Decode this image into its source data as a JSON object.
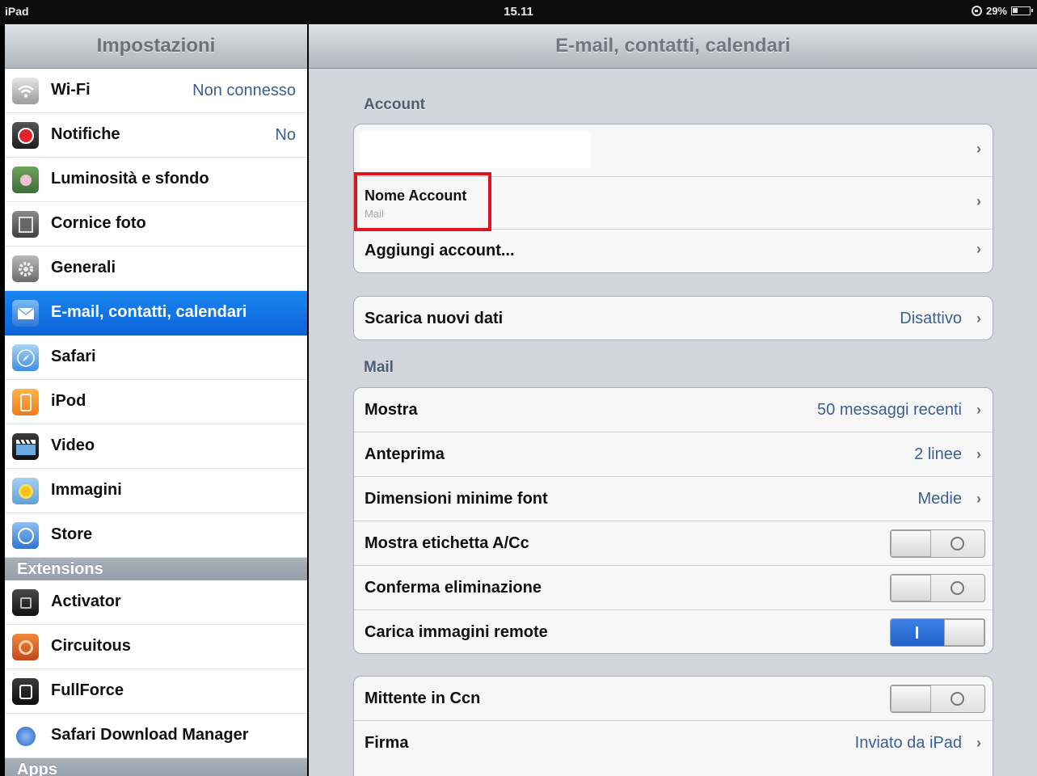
{
  "status_bar": {
    "device": "iPad",
    "time": "15.11",
    "battery": "29%"
  },
  "left_pane": {
    "title": "Impostazioni",
    "items": [
      {
        "label": "Wi-Fi",
        "value": "Non connesso",
        "icon": "wifi-icon"
      },
      {
        "label": "Notifiche",
        "value": "No",
        "icon": "notifications-icon"
      },
      {
        "label": "Luminosità e sfondo",
        "value": "",
        "icon": "brightness-wallpaper-icon"
      },
      {
        "label": "Cornice foto",
        "value": "",
        "icon": "picture-frame-icon"
      },
      {
        "label": "Generali",
        "value": "",
        "icon": "gear-icon"
      },
      {
        "label": "E-mail, contatti, calendari",
        "value": "",
        "icon": "mail-icon",
        "selected": true
      },
      {
        "label": "Safari",
        "value": "",
        "icon": "safari-compass-icon"
      },
      {
        "label": "iPod",
        "value": "",
        "icon": "ipod-icon"
      },
      {
        "label": "Video",
        "value": "",
        "icon": "video-clapper-icon"
      },
      {
        "label": "Immagini",
        "value": "",
        "icon": "sunflower-photos-icon"
      },
      {
        "label": "Store",
        "value": "",
        "icon": "store-icon"
      }
    ],
    "extensions_header": "Extensions",
    "extensions": [
      {
        "label": "Activator",
        "icon": "activator-icon"
      },
      {
        "label": "Circuitous",
        "icon": "circuitous-icon"
      },
      {
        "label": "FullForce",
        "icon": "fullforce-icon"
      },
      {
        "label": "Safari Download Manager",
        "icon": "download-manager-icon"
      }
    ],
    "apps_header": "Apps"
  },
  "right_pane": {
    "title": "E-mail, contatti, calendari",
    "account_header": "Account",
    "account_name": "Nome Account",
    "account_sub": "Mail",
    "add_account": "Aggiungi account...",
    "fetch_label": "Scarica nuovi dati",
    "fetch_value": "Disattivo",
    "mail_header": "Mail",
    "mail_rows": [
      {
        "label": "Mostra",
        "value": "50 messaggi recenti",
        "type": "disclosure"
      },
      {
        "label": "Anteprima",
        "value": "2 linee",
        "type": "disclosure"
      },
      {
        "label": "Dimensioni minime font",
        "value": "Medie",
        "type": "disclosure"
      },
      {
        "label": "Mostra etichetta A/Cc",
        "value": "off",
        "type": "toggle"
      },
      {
        "label": "Conferma eliminazione",
        "value": "off",
        "type": "toggle"
      },
      {
        "label": "Carica immagini remote",
        "value": "on",
        "type": "toggle"
      }
    ],
    "bcc_label": "Mittente in Ccn",
    "bcc_value": "off",
    "signature_label": "Firma",
    "signature_value": "Inviato da iPad"
  },
  "colors": {
    "selection_blue": "#0d63d8",
    "value_blue": "#3b5f93",
    "highlight_red": "#e0141e"
  }
}
